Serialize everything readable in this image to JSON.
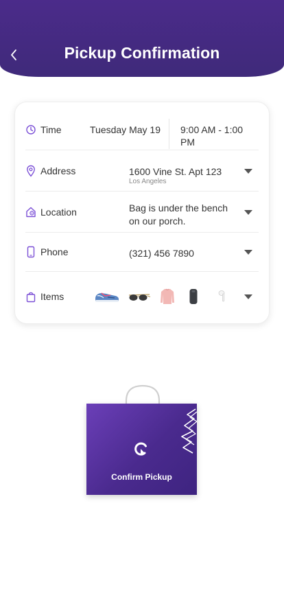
{
  "header": {
    "title": "Pickup Confirmation",
    "back_icon": "chevron-left-icon"
  },
  "details": {
    "time": {
      "label": "Time",
      "date": "Tuesday May 19",
      "window": "9:00 AM - 1:00 PM",
      "icon": "clock-icon"
    },
    "address": {
      "label": "Address",
      "line1": "1600 Vine St. Apt 123",
      "city": "Los Angeles",
      "icon": "map-pin-icon"
    },
    "location": {
      "label": "Location",
      "line1": "Bag is under the bench",
      "line2": "on our porch.",
      "icon": "home-pin-icon"
    },
    "phone": {
      "label": "Phone",
      "number": "(321) 456 7890",
      "icon": "phone-icon"
    },
    "items": {
      "label": "Items",
      "icon": "bag-icon",
      "thumbnails": [
        "sneaker",
        "sunglasses",
        "pink-sweater",
        "speaker",
        "earbud"
      ]
    }
  },
  "confirm": {
    "label": "Confirm Pickup",
    "logo_icon": "refresh-logo-icon"
  },
  "colors": {
    "brand_purple": "#4b2b8a",
    "accent_purple": "#7b4fd6",
    "card_border": "#eeeeee"
  }
}
